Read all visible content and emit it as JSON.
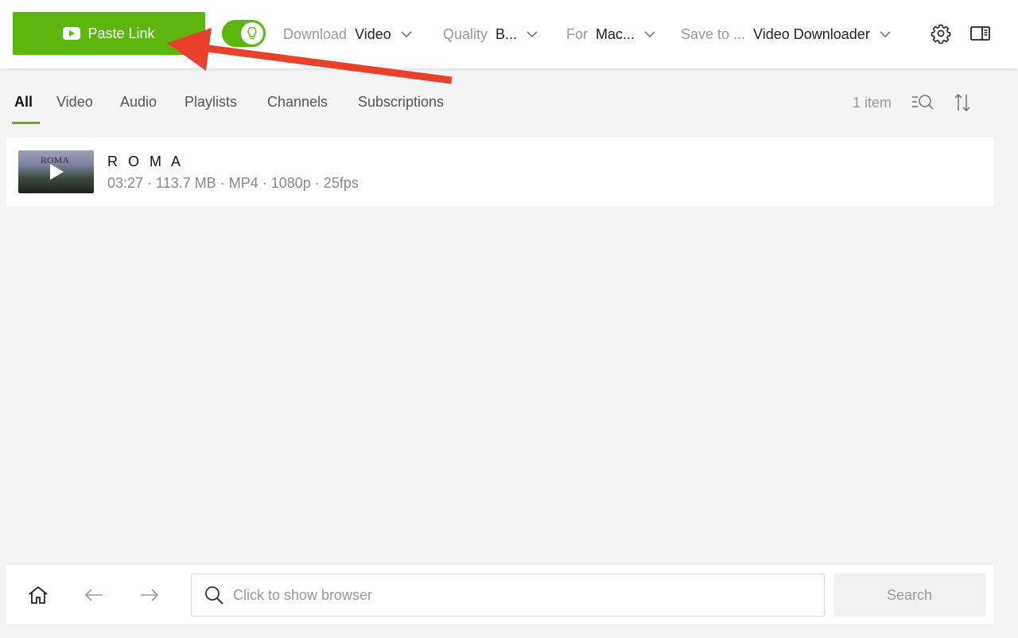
{
  "toolbar": {
    "paste_link_label": "Paste Link",
    "smart_mode_on": true,
    "download": {
      "label": "Download",
      "value": "Video"
    },
    "quality": {
      "label": "Quality",
      "value": "B..."
    },
    "for": {
      "label": "For",
      "value": "Mac..."
    },
    "save_to": {
      "label": "Save to ...",
      "value": "Video Downloader"
    }
  },
  "tabs": [
    {
      "label": "All",
      "active": true
    },
    {
      "label": "Video"
    },
    {
      "label": "Audio"
    },
    {
      "label": "Playlists"
    },
    {
      "label": "Channels"
    },
    {
      "label": "Subscriptions"
    }
  ],
  "list": {
    "count_label": "1 item",
    "items": [
      {
        "thumb_text": "ROMA",
        "title": "R O M A",
        "meta": "03:27 · 113.7 MB · MP4 · 1080p · 25fps"
      }
    ]
  },
  "bottom": {
    "search_placeholder": "Click to show browser",
    "search_button": "Search"
  },
  "colors": {
    "accent": "#5bb60d",
    "annotation_arrow": "#e8402a",
    "background": "#f4f4f4"
  }
}
